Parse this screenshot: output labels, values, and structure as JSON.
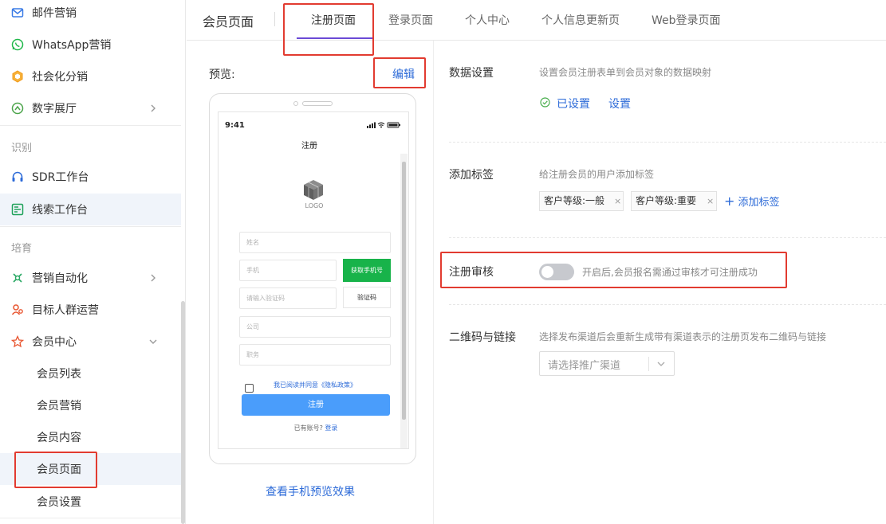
{
  "sidebar": {
    "items": [
      {
        "label": "邮件营销",
        "icon": "mail-icon",
        "color": "#3a7be6"
      },
      {
        "label": "WhatsApp营销",
        "icon": "whatsapp-icon",
        "color": "#1fb84a"
      },
      {
        "label": "社会化分销",
        "icon": "share-hex-icon",
        "color": "#f19a18"
      },
      {
        "label": "数字展厅",
        "icon": "exhibition-icon",
        "color": "#4ba44a"
      }
    ],
    "section_identify": "识别",
    "identify_items": [
      {
        "label": "SDR工作台",
        "icon": "headset-icon",
        "color": "#2d6bd8"
      },
      {
        "label": "线索工作台",
        "icon": "clue-board-icon",
        "color": "#1fa15a"
      }
    ],
    "section_nurture": "培育",
    "nurture_items": [
      {
        "label": "营销自动化",
        "icon": "automation-icon",
        "color": "#2aa864"
      },
      {
        "label": "目标人群运营",
        "icon": "audience-icon",
        "color": "#e8542e"
      },
      {
        "label": "会员中心",
        "icon": "member-icon",
        "color": "#e8542e"
      }
    ],
    "member_sub": [
      "会员列表",
      "会员营销",
      "会员内容",
      "会员页面",
      "会员设置"
    ]
  },
  "topbar": {
    "title": "会员页面",
    "tabs": [
      "注册页面",
      "登录页面",
      "个人中心",
      "个人信息更新页",
      "Web登录页面"
    ]
  },
  "preview": {
    "label": "预览:",
    "edit": "编辑",
    "mobile_link": "查看手机预览效果",
    "phone": {
      "time": "9:41",
      "title": "注册",
      "logo_text": "LOGO",
      "fields": {
        "name": "姓名",
        "phone": "手机",
        "code": "请输入验证码",
        "company": "公司",
        "position": "职务"
      },
      "get_phone_btn": "获取手机号",
      "verify_btn": "验证码",
      "agree_text": "我已阅读并同意《隐私政策》",
      "register_btn": "注册",
      "have_account": "已有账号?",
      "login": "登录"
    }
  },
  "settings": {
    "data_setting": {
      "label": "数据设置",
      "desc": "设置会员注册表单到会员对象的数据映射",
      "status": "已设置",
      "link": "设置"
    },
    "add_tag": {
      "label": "添加标签",
      "desc": "给注册会员的用户添加标签",
      "tags": [
        "客户等级:一般",
        "客户等级:重要"
      ],
      "add_link": "添加标签"
    },
    "review": {
      "label": "注册审核",
      "desc": "开启后,会员报名需通过审核才可注册成功",
      "enabled": false
    },
    "qrcode": {
      "label": "二维码与链接",
      "desc": "选择发布渠道后会重新生成带有渠道表示的注册页发布二维码与链接",
      "select_placeholder": "请选择推广渠道"
    }
  },
  "colors": {
    "accent_blue": "#2d6bd8",
    "tab_underline": "#6b4ad6",
    "annotation_red": "#e23b30",
    "register_btn": "#4a9dfb",
    "get_phone_btn": "#18b34a"
  }
}
